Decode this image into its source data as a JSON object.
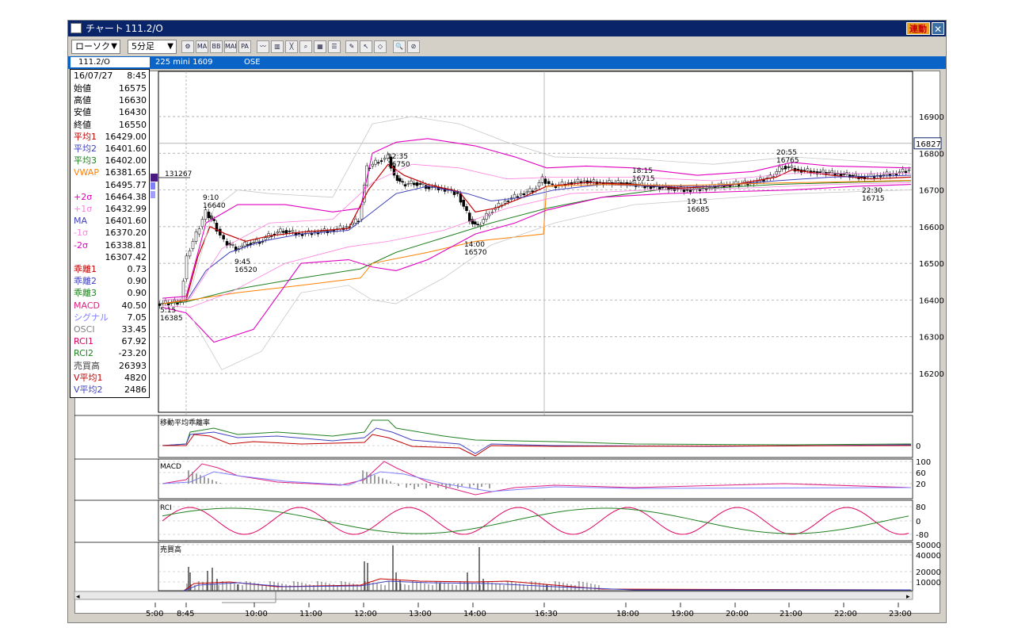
{
  "window": {
    "title": "チャート",
    "symbol_title": "111.2/O",
    "renkan_label": "連動",
    "close_label": "✕"
  },
  "toolbar": {
    "chart_type": "ローソク",
    "interval": "5分足",
    "icons": [
      "chart-config-icon",
      "ma-icon",
      "bb-icon",
      "mae-icon",
      "pa-icon",
      "line-icon",
      "candle-icon",
      "stoch-icon",
      "zoom-icon",
      "grid-icon",
      "pen-icon",
      "cursor-icon",
      "eraser-icon",
      "search-icon",
      "no-draw-icon"
    ],
    "icon_labels": {
      "ma": "MA",
      "bb": "BB",
      "mae": "MAE",
      "pa": "PA"
    }
  },
  "infobar": {
    "symbol": "111.2/O",
    "name": "225 mini 1609",
    "exchange": "OSE"
  },
  "data_panel": {
    "date": "16/07/27",
    "time": "8:45",
    "rows": [
      {
        "label": "始値",
        "value": "16575",
        "color": "#000000"
      },
      {
        "label": "高値",
        "value": "16630",
        "color": "#000000"
      },
      {
        "label": "安値",
        "value": "16430",
        "color": "#000000"
      },
      {
        "label": "終値",
        "value": "16550",
        "color": "#000000"
      },
      {
        "label": "平均1",
        "value": "16429.00",
        "color": "#c00000"
      },
      {
        "label": "平均2",
        "value": "16401.60",
        "color": "#4040c0"
      },
      {
        "label": "平均3",
        "value": "16402.00",
        "color": "#208020"
      },
      {
        "label": "VWAP",
        "value": "16381.65",
        "color": "#ff8000"
      },
      {
        "label": "",
        "value": "16495.77",
        "color": "#000000"
      },
      {
        "label": "+2σ",
        "value": "16464.38",
        "color": "#e000c0"
      },
      {
        "label": "+1σ",
        "value": "16432.99",
        "color": "#ff80e0"
      },
      {
        "label": "MA",
        "value": "16401.60",
        "color": "#4040c0"
      },
      {
        "label": "-1σ",
        "value": "16370.20",
        "color": "#ff80e0"
      },
      {
        "label": "-2σ",
        "value": "16338.81",
        "color": "#e000c0"
      },
      {
        "label": "",
        "value": "16307.42",
        "color": "#000000"
      },
      {
        "label": "乖離1",
        "value": "0.73",
        "color": "#c00000"
      },
      {
        "label": "乖離2",
        "value": "0.90",
        "color": "#4040c0"
      },
      {
        "label": "乖離3",
        "value": "0.90",
        "color": "#208020"
      },
      {
        "label": "MACD",
        "value": "40.50",
        "color": "#e0208080"
      },
      {
        "label": "シグナル",
        "value": "7.05",
        "color": "#8080ff"
      },
      {
        "label": "OSCI",
        "value": "33.45",
        "color": "#808080"
      },
      {
        "label": "RCI1",
        "value": "67.92",
        "color": "#e00060"
      },
      {
        "label": "RCI2",
        "value": "-23.20",
        "color": "#208020"
      },
      {
        "label": "売買高",
        "value": "26393",
        "color": "#404040"
      },
      {
        "label": "V平均1",
        "value": "4820",
        "color": "#c00000"
      },
      {
        "label": "V平均2",
        "value": "2486",
        "color": "#4040c0"
      }
    ]
  },
  "main_chart": {
    "y_ticks": [
      "16900",
      "16800",
      "16700",
      "16600",
      "16500",
      "16400",
      "16300",
      "16200"
    ],
    "current_price": "16827",
    "cursor_value": "131267",
    "annotations": [
      {
        "time": "9:10",
        "price": "16640"
      },
      {
        "time": "9:45",
        "price": "16520"
      },
      {
        "time": "5:15",
        "price": "16385"
      },
      {
        "time": "12:35",
        "price": "16750"
      },
      {
        "time": "14:00",
        "price": "16570"
      },
      {
        "time": "18:15",
        "price": "16715"
      },
      {
        "time": "19:15",
        "price": "16685"
      },
      {
        "time": "20:55",
        "price": "16765"
      },
      {
        "time": "22:30",
        "price": "16715"
      }
    ]
  },
  "sub_charts": {
    "deviation": {
      "title": "移動平均乖離率",
      "ticks": [
        "0"
      ]
    },
    "macd": {
      "title": "MACD",
      "ticks": [
        "100",
        "60",
        "20"
      ]
    },
    "rci": {
      "title": "RCI",
      "ticks": [
        "80",
        "0",
        "-80"
      ]
    },
    "volume": {
      "title": "売買高",
      "ticks": [
        "50000",
        "40000",
        "20000",
        "10000"
      ]
    }
  },
  "x_axis": {
    "ticks": [
      "5:00",
      "8:45",
      "10:00",
      "11:00",
      "12:00",
      "13:00",
      "14:00",
      "16:30",
      "18:00",
      "19:00",
      "20:00",
      "21:00",
      "22:00",
      "23:00"
    ]
  },
  "colors": {
    "title_bg": "#0a246a",
    "info_bg": "#0a64c8",
    "candle": "#000000",
    "ma1": "#c00000",
    "ma2": "#4040c0",
    "ma3": "#208020",
    "vwap": "#ff8000",
    "bb2": "#e000c0",
    "bb1": "#ff80e0",
    "bb3": "#c8c8c8"
  }
}
